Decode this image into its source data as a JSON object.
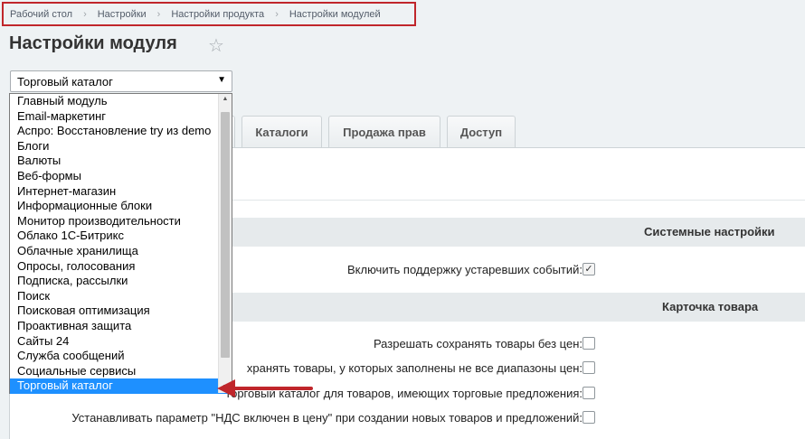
{
  "breadcrumb": [
    "Рабочий стол",
    "Настройки",
    "Настройки продукта",
    "Настройки модулей"
  ],
  "page_title": "Настройки модуля",
  "module_select": {
    "value": "Торговый каталог"
  },
  "tabs": [
    "Каталоги",
    "Продажа прав",
    "Доступ"
  ],
  "sections": {
    "system": "Системные настройки",
    "product_card": "Карточка товара"
  },
  "options": {
    "legacy_events": "Включить поддержку устаревших событий:",
    "save_without_price": "Разрешать сохранять товары без цен:",
    "save_partial_ranges": "хранять товары, у которых заполнены не все диапазоны цен:",
    "show_catalog": "торговый каталог для товаров, имеющих торговые предложения:",
    "vat_included": "Устанавливать параметр \"НДС включен в цену\" при создании новых товаров и предложений:"
  },
  "dropdown_options": [
    "Главный модуль",
    "Email-маркетинг",
    "Аспро: Восстановление try из demo",
    "Блоги",
    "Валюты",
    "Веб-формы",
    "Интернет-магазин",
    "Информационные блоки",
    "Монитор производительности",
    "Облако 1С-Битрикс",
    "Облачные хранилища",
    "Опросы, голосования",
    "Подписка, рассылки",
    "Поиск",
    "Поисковая оптимизация",
    "Проактивная защита",
    "Сайты 24",
    "Служба сообщений",
    "Социальные сервисы",
    "Торговый каталог"
  ],
  "selected_index": 19,
  "colors": {
    "annotation": "#c0262b",
    "selection": "#1e90ff"
  }
}
